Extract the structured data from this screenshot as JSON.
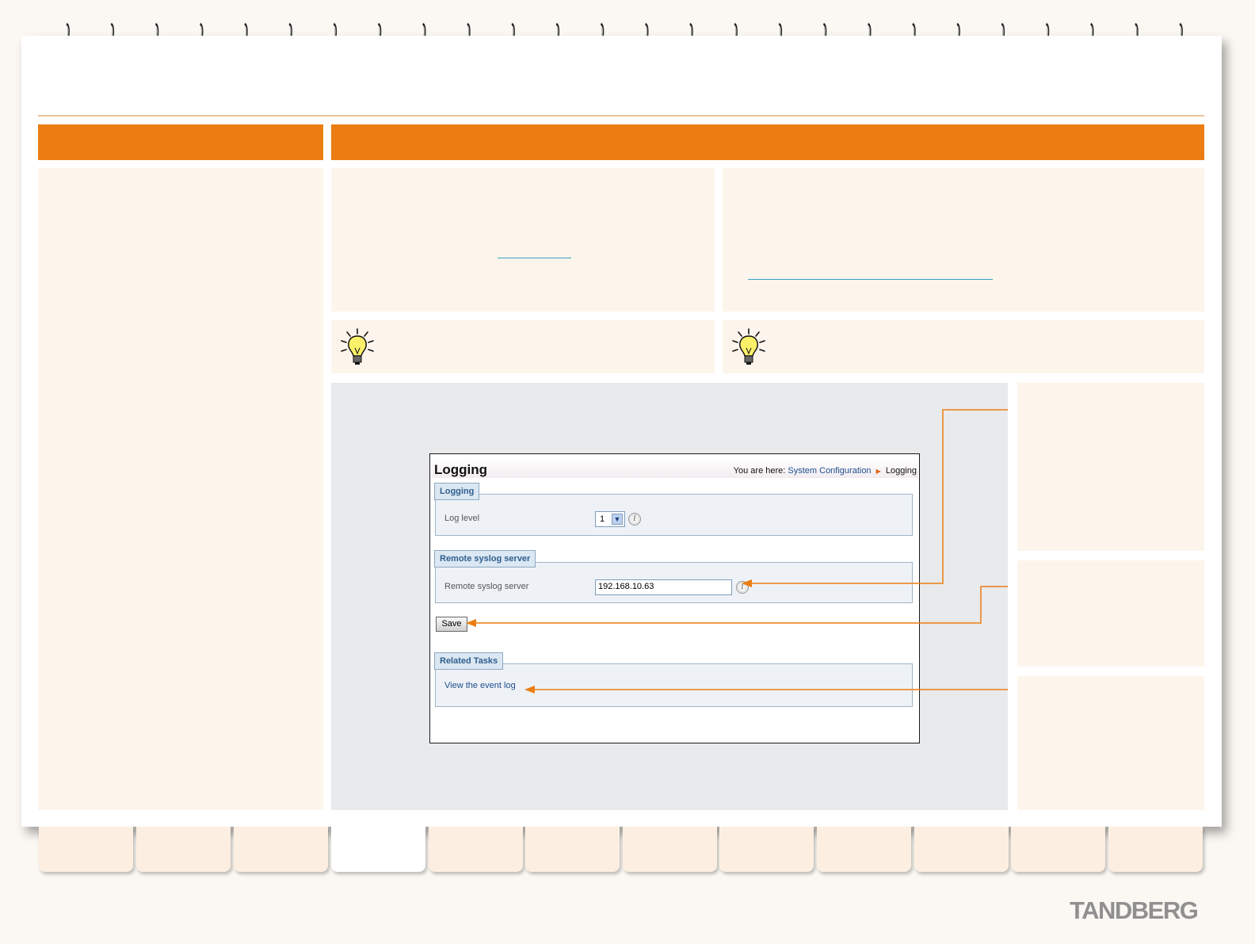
{
  "embedded_ui": {
    "title": "Logging",
    "breadcrumb": {
      "prefix": "You are here:",
      "items": [
        "System Configuration",
        "Logging"
      ]
    },
    "sections": {
      "logging": {
        "legend": "Logging",
        "log_level_label": "Log level",
        "log_level_value": "1"
      },
      "remote_syslog": {
        "legend": "Remote syslog server",
        "field_label": "Remote syslog server",
        "field_value": "192.168.10.63"
      },
      "related_tasks": {
        "legend": "Related Tasks",
        "link": "View the event log"
      }
    },
    "save_label": "Save"
  },
  "icons": {
    "info": "i",
    "select_arrow": "▼"
  },
  "footer": {
    "logo": "TANDBERG"
  },
  "colors": {
    "accent": "#eb7d12",
    "panel": "#fdf5ec",
    "link": "#3aa0c8"
  }
}
